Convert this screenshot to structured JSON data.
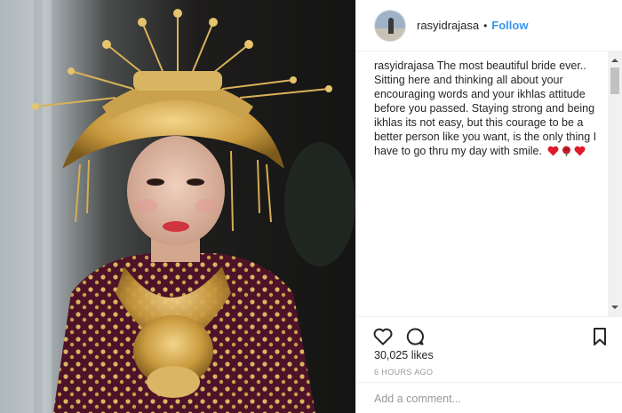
{
  "post": {
    "username": "rasyidrajasa",
    "separator": "•",
    "follow_label": "Follow",
    "caption_text": " The most beautiful bride ever.. Sitting here and thinking all about your encouraging words and your ikhlas attitude before you passed. Staying strong and being ikhlas its not easy, but this courage to be a better person like you want, is the only thing I have to go thru my day with smile.",
    "caption_emoji": [
      "heart-icon",
      "rose-icon",
      "heart-icon"
    ],
    "likes": "30,025 likes",
    "time_ago": "6 HOURS AGO",
    "comment_placeholder": "Add a comment..."
  },
  "icons": {
    "like": "heart-outline-icon",
    "comment": "speech-bubble-icon",
    "save": "bookmark-icon"
  },
  "colors": {
    "follow": "#3897f0",
    "text": "#262626",
    "muted": "#999999",
    "border": "#efefef",
    "emoji_heart": "#e0192b"
  }
}
